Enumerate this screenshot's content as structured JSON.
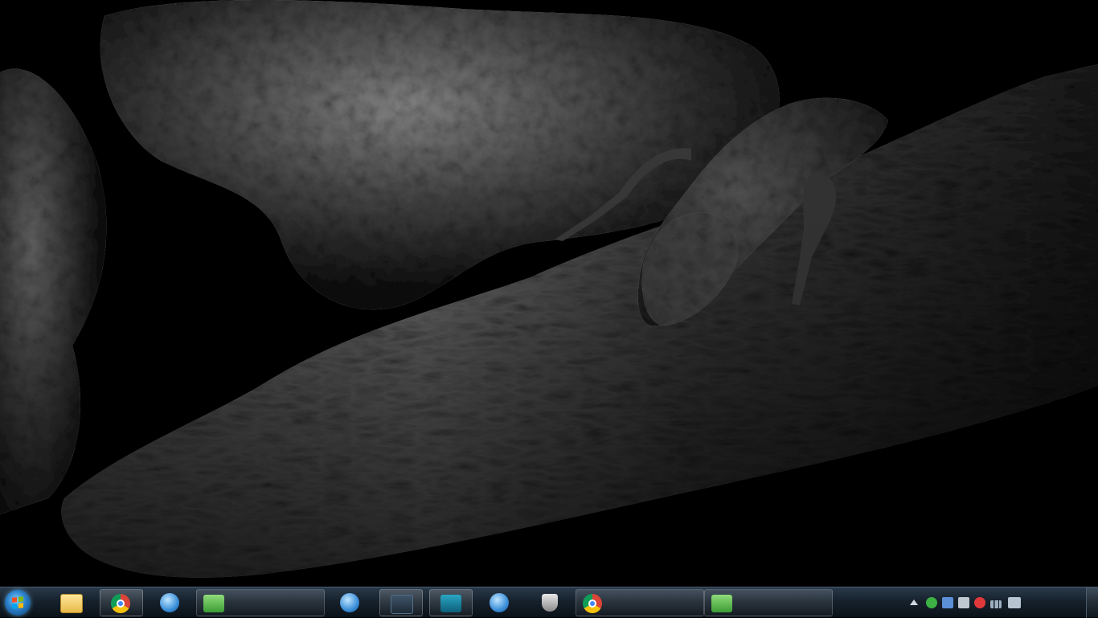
{
  "desktop": {
    "wallpaper": "lizard-on-branch-monochrome"
  },
  "taskbar": {
    "start_icon": "windows-start-icon",
    "buttons": [
      {
        "icon": "folder-icon",
        "label": ""
      },
      {
        "icon": "chrome-icon",
        "label": ""
      },
      {
        "icon": "globe-icon",
        "label": ""
      },
      {
        "icon": "app-window-icon",
        "label": ""
      },
      {
        "icon": "globe-icon",
        "label": ""
      },
      {
        "icon": "window-icon",
        "label": ""
      },
      {
        "icon": "terminal-icon",
        "label": ""
      },
      {
        "icon": "globe-icon",
        "label": ""
      },
      {
        "icon": "shield-icon",
        "label": ""
      },
      {
        "icon": "chrome-icon",
        "label": ""
      },
      {
        "icon": "app-window-icon",
        "label": ""
      }
    ],
    "tray": {
      "icons": [
        "show-hidden-icon",
        "network-icon",
        "app-icon",
        "flag-icon",
        "antivirus-icon",
        "signal-icon",
        "volume-icon"
      ],
      "clock_time": "",
      "clock_date": ""
    },
    "colors": {
      "bar_top": "#2a3a4a",
      "bar_bottom": "#0b1219"
    }
  }
}
